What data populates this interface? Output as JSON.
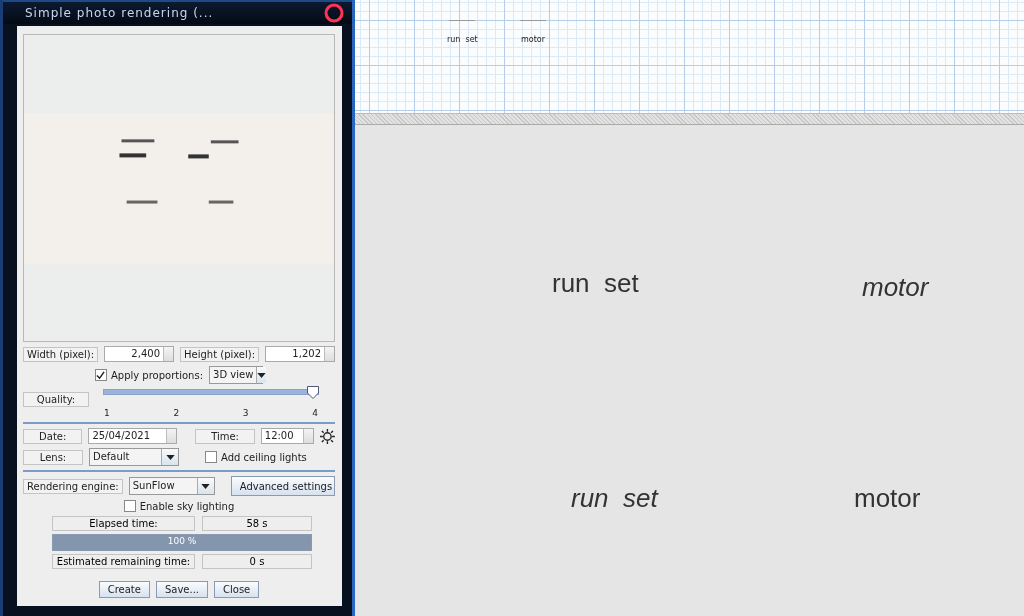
{
  "window": {
    "title": "Simple photo rendering (..."
  },
  "preview": {
    "kind": "picture"
  },
  "size": {
    "width_label": "Width (pixel):",
    "width_value": "2,400",
    "height_label": "Height (pixel):",
    "height_value": "1,202"
  },
  "proportions": {
    "label": "Apply proportions:",
    "checked": true,
    "combo": "3D view"
  },
  "quality": {
    "label": "Quality:",
    "level": 1,
    "ticks": [
      "1",
      "2",
      "3",
      "4"
    ]
  },
  "date": {
    "label": "Date:",
    "value": "25/04/2021"
  },
  "time": {
    "label": "Time:",
    "value": "12:00"
  },
  "lens": {
    "label": "Lens:",
    "value": "Default"
  },
  "ceiling_lights": {
    "label": "Add ceiling lights",
    "checked": false
  },
  "engine": {
    "label": "Rendering engine:",
    "value": "SunFlow",
    "button": "Advanced settings"
  },
  "sky_lighting": {
    "label": "Enable sky lighting",
    "checked": false
  },
  "elapsed": {
    "label": "Elapsed time:",
    "value": "58 s"
  },
  "progress": {
    "level": 1,
    "text": "100 %"
  },
  "remaining": {
    "label": "Estimated remaining time:",
    "value": "0 s"
  },
  "buttons": [
    "Create",
    "Save...",
    "Close"
  ],
  "plan": {
    "labels": [
      {
        "text": "run  set"
      },
      {
        "text": "motor"
      }
    ]
  },
  "view3d": {
    "labels": [
      {
        "text": "run  set",
        "italic": false
      },
      {
        "text": "motor",
        "italic": true
      },
      {
        "text": "run  set",
        "italic": true
      },
      {
        "text": "motor",
        "italic": false
      }
    ]
  }
}
